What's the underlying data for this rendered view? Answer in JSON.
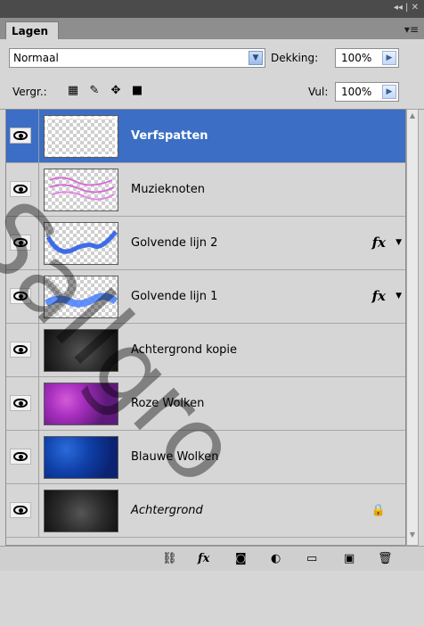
{
  "panel": {
    "tab_label": "Lagen",
    "top_controls": "◂◂ | ✕",
    "menu_icon": "▾≡"
  },
  "blend": {
    "mode": "Normaal",
    "opacity_label": "Dekking:",
    "opacity_value": "100%",
    "lock_label": "Vergr.:",
    "fill_label": "Vul:",
    "fill_value": "100%"
  },
  "layers": [
    {
      "name": "Verfspatten",
      "selected": true,
      "fx": false,
      "locked": false,
      "thumb": "checker"
    },
    {
      "name": "Muzieknoten",
      "selected": false,
      "fx": false,
      "locked": false,
      "thumb": "checker"
    },
    {
      "name": "Golvende lijn 2",
      "selected": false,
      "fx": true,
      "locked": false,
      "thumb": "checker"
    },
    {
      "name": "Golvende lijn 1",
      "selected": false,
      "fx": true,
      "locked": false,
      "thumb": "checker"
    },
    {
      "name": "Achtergrond kopie",
      "selected": false,
      "fx": false,
      "locked": false,
      "thumb": "black"
    },
    {
      "name": "Roze Wolken",
      "selected": false,
      "fx": false,
      "locked": false,
      "thumb": "pink"
    },
    {
      "name": "Blauwe Wolken",
      "selected": false,
      "fx": false,
      "locked": false,
      "thumb": "blue"
    },
    {
      "name": "Achtergrond",
      "selected": false,
      "fx": false,
      "locked": true,
      "thumb": "black"
    }
  ],
  "fx_label": "fx",
  "lock_glyph": "🔒",
  "watermark": "Sallgro",
  "bottom_fx": "fx"
}
